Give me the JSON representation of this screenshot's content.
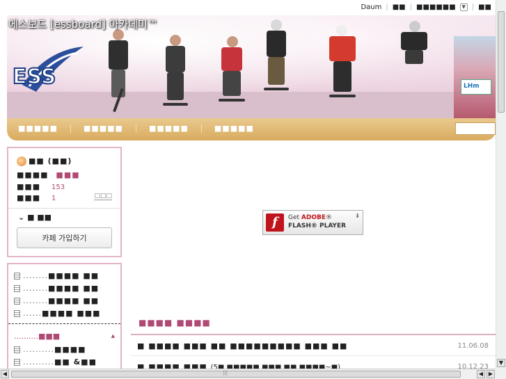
{
  "gnb": {
    "daum": "Daum",
    "link1": "■■",
    "link2": "■■■■■■",
    "link3": "■■",
    "dropdown_icon": "chevron-down-icon"
  },
  "banner": {
    "title": "에스보드 [essboard] 아카데미™",
    "logo_text": "ESS",
    "crowd_sign": "LHm"
  },
  "nav": {
    "items": [
      "■■■■■",
      "■■■■■",
      "■■■■■",
      "■■■■■"
    ]
  },
  "profile": {
    "name": "■■ (■■)",
    "row1_label": "■■■■",
    "row1_value": "■■■",
    "row2_label": "■■■",
    "row2_value": "153",
    "row3_label": "■■■",
    "row3_value": "1",
    "small_link": "□□□",
    "menu_label": "■ ■■",
    "join_button": "카페 가입하기"
  },
  "menu": {
    "items": [
      {
        "dots": "........",
        "label": "■■■■ ■■"
      },
      {
        "dots": "........",
        "label": "■■■■ ■■"
      },
      {
        "dots": "........",
        "label": "■■■■ ■■"
      },
      {
        "dots": "......",
        "label": "■■■■ ■■■"
      }
    ],
    "category": {
      "dots": "..........",
      "label": "■■■"
    },
    "sub_items": [
      {
        "dots": "..........",
        "label": "■■■■"
      },
      {
        "dots": "..........",
        "label": "■■ &■■"
      }
    ]
  },
  "flash": {
    "get": "Get",
    "adobe": "ADOBE",
    "player": "FLASH® PLAYER"
  },
  "board": {
    "title": "■■■■ ■■■■",
    "posts": [
      {
        "title": "■ ■■■■ ■■■ ■■ ■■■■■■■■■ ■■■ ■■",
        "comment": "",
        "date": "11.06.08"
      },
      {
        "title": "■ ■■■■ ■■■",
        "comment": "(5■ ■■■■■ ■■■ ■■ ■■■■~■)",
        "date": "10.12.23"
      }
    ]
  },
  "colors": {
    "accent_pink": "#b04a74",
    "nav_gold": "#d9ab5e",
    "panel_border": "#e3b4c8"
  }
}
